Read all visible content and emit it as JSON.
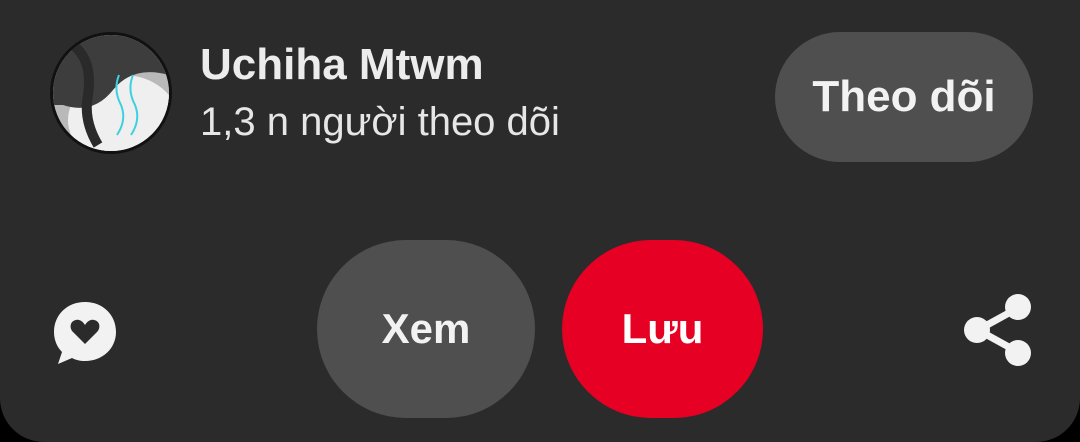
{
  "profile": {
    "username": "Uchiha Mtwm",
    "followers": "1,3 n người theo dõi",
    "avatar_icon": "profile-photo"
  },
  "follow_button": {
    "label": "Theo dõi"
  },
  "actions": {
    "comment_icon": "comment-heart-icon",
    "view_label": "Xem",
    "save_label": "Lưu",
    "share_icon": "share-icon"
  },
  "colors": {
    "background": "#2b2b2b",
    "secondary_button": "#4f4f4f",
    "primary_button": "#e60023",
    "text": "#ececec"
  }
}
